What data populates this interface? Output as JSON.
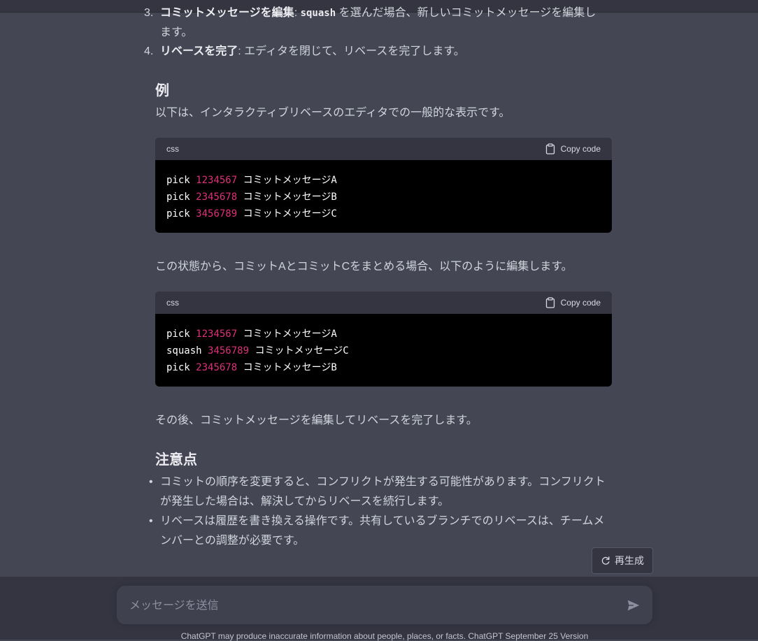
{
  "list": {
    "item3": {
      "num": "3.",
      "bold": "コミットメッセージを編集",
      "colon": ": ",
      "code": "squash",
      "text1": " を選んだ場合、新しいコミットメッセージを編集し",
      "text2": "ます。"
    },
    "item4": {
      "num": "4.",
      "bold": "リベースを完了",
      "text": ": エディタを閉じて、リベースを完了します。"
    }
  },
  "example": {
    "heading": "例",
    "intro": "以下は、インタラクティブリベースのエディタでの一般的な表示です。",
    "block1": {
      "lang": "css",
      "copy_label": "Copy code",
      "lines": [
        {
          "cmd": "pick",
          "hash": "1234567",
          "msg": "コミットメッセージA"
        },
        {
          "cmd": "pick",
          "hash": "2345678",
          "msg": "コミットメッセージB"
        },
        {
          "cmd": "pick",
          "hash": "3456789",
          "msg": "コミットメッセージC"
        }
      ]
    },
    "middle": "この状態から、コミットAとコミットCをまとめる場合、以下のように編集します。",
    "block2": {
      "lang": "css",
      "copy_label": "Copy code",
      "lines": [
        {
          "cmd": "pick",
          "hash": "1234567",
          "msg": "コミットメッセージA"
        },
        {
          "cmd": "squash",
          "hash": "3456789",
          "msg": "コミットメッセージC"
        },
        {
          "cmd": "pick",
          "hash": "2345678",
          "msg": "コミットメッセージB"
        }
      ]
    },
    "after": "その後、コミットメッセージを編集してリベースを完了します。"
  },
  "notes": {
    "heading": "注意点",
    "bullets": [
      {
        "line1": "コミットの順序を変更すると、コンフリクトが発生する可能性があります。コンフリクト",
        "line2": "が発生した場合は、解決してからリベースを続行します。"
      },
      {
        "line1": "リベースは履歴を書き換える操作です。共有しているブランチでのリベースは、チームメ",
        "line2": "ンバーとの調整が必要です。"
      }
    ]
  },
  "regenerate_label": "再生成",
  "composer": {
    "placeholder": "メッセージを送信"
  },
  "footer": "ChatGPT may produce inaccurate information about people, places, or facts. ChatGPT September 25 Version",
  "colors": {
    "background": "#444654",
    "code_hash": "#df3079",
    "composer_bg": "#40414f"
  }
}
